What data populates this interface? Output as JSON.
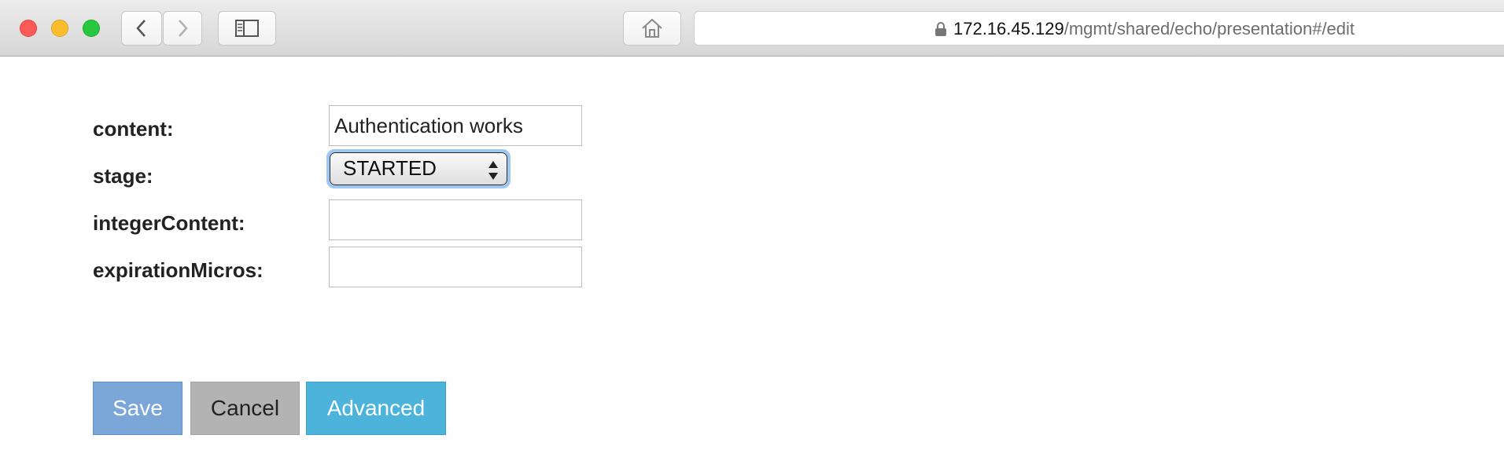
{
  "browser": {
    "url_host": "172.16.45.129",
    "url_path": "/mgmt/shared/echo/presentation#/edit",
    "icons": [
      "lock-icon",
      "back-icon",
      "forward-icon",
      "sidebar-icon",
      "home-icon"
    ]
  },
  "form": {
    "content_label": "content:",
    "content_value": "Authentication works",
    "stage_label": "stage:",
    "stage_value": "STARTED",
    "integer_content_label": "integerContent:",
    "integer_content_value": "",
    "expiration_micros_label": "expirationMicros:",
    "expiration_micros_value": ""
  },
  "buttons": {
    "save": "Save",
    "cancel": "Cancel",
    "advanced": "Advanced"
  },
  "colors": {
    "save": "#7ba7d8",
    "cancel": "#b3b3b3",
    "advanced": "#4cb3db",
    "focus_ring": "#9cc8f3"
  }
}
